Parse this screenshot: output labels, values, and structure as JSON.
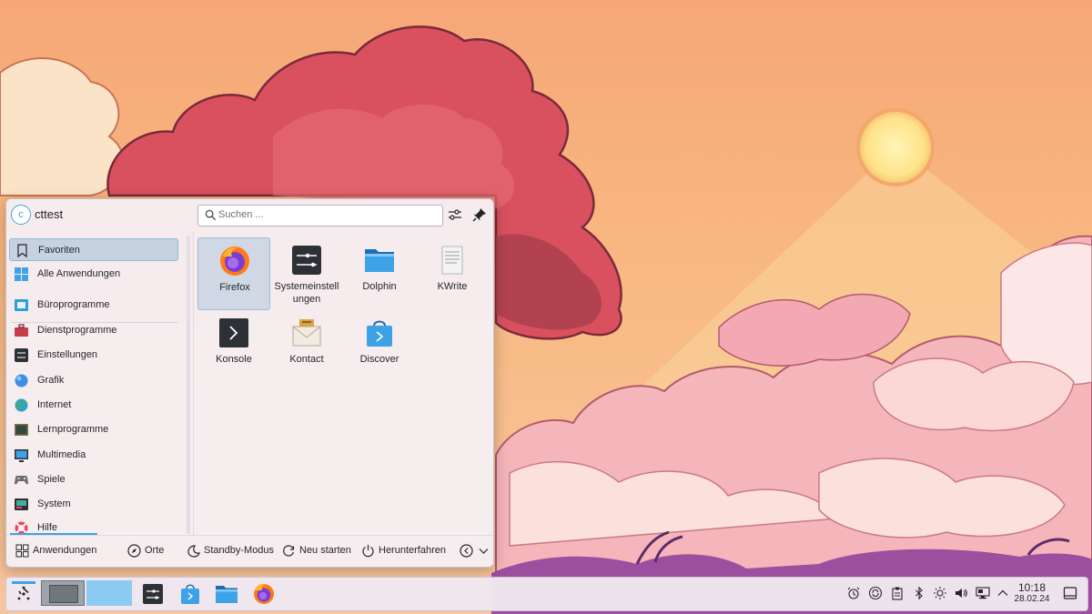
{
  "user": {
    "initial": "c",
    "name": "cttest"
  },
  "search": {
    "placeholder": "Suchen ..."
  },
  "sidebar": {
    "items": [
      {
        "label": "Favoriten",
        "icon": "bookmark-icon"
      },
      {
        "label": "Alle Anwendungen",
        "icon": "grid-icon"
      },
      {
        "label": "Büroprogramme",
        "icon": "office-icon"
      },
      {
        "label": "Dienstprogramme",
        "icon": "toolbox-icon"
      },
      {
        "label": "Einstellungen",
        "icon": "settings-icon"
      },
      {
        "label": "Grafik",
        "icon": "graphics-icon"
      },
      {
        "label": "Internet",
        "icon": "globe-icon"
      },
      {
        "label": "Lernprogramme",
        "icon": "chalkboard-icon"
      },
      {
        "label": "Multimedia",
        "icon": "monitor-icon"
      },
      {
        "label": "Spiele",
        "icon": "gamepad-icon"
      },
      {
        "label": "System",
        "icon": "system-icon"
      },
      {
        "label": "Hilfe",
        "icon": "lifebuoy-icon"
      }
    ]
  },
  "favorites": [
    {
      "label": "Firefox",
      "icon": "firefox-icon"
    },
    {
      "label": "Systemeinstellungen",
      "label_lines": [
        "Systemeinstell",
        "ungen"
      ],
      "icon": "system-settings-icon"
    },
    {
      "label": "Dolphin",
      "icon": "folder-icon"
    },
    {
      "label": "KWrite",
      "icon": "text-editor-icon"
    },
    {
      "label": "Konsole",
      "icon": "terminal-icon"
    },
    {
      "label": "Kontact",
      "icon": "mail-icon"
    },
    {
      "label": "Discover",
      "icon": "store-icon"
    }
  ],
  "footer": {
    "applications": "Anwendungen",
    "places": "Orte",
    "sleep": "Standby-Modus",
    "restart": "Neu starten",
    "shutdown": "Herunterfahren"
  },
  "panel": {
    "time": "10:18",
    "date": "28.02.24",
    "task_icons": [
      "system-settings-icon",
      "store-icon",
      "folder-icon",
      "firefox-icon"
    ],
    "tray_icons": [
      "alarm-icon",
      "update-icon",
      "clipboard-icon",
      "bluetooth-icon",
      "brightness-icon",
      "volume-icon",
      "network-icon",
      "expand-tray-icon"
    ]
  },
  "colors": {
    "accent": "#3da3e6",
    "selection": "#a0bed7"
  }
}
